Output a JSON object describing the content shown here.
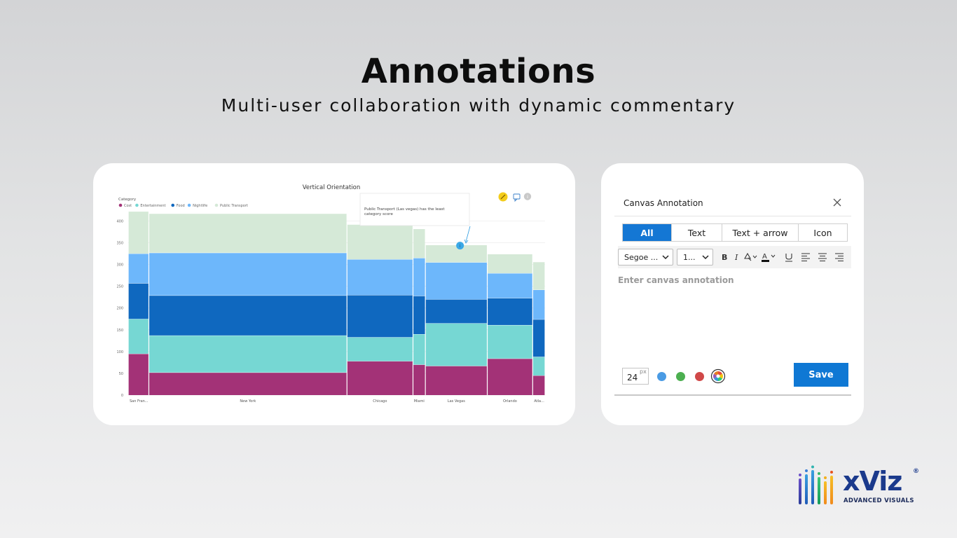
{
  "page": {
    "title": "Annotations",
    "subtitle": "Multi-user collaboration with dynamic commentary"
  },
  "chart_data": {
    "type": "bar",
    "title": "Vertical Orientation",
    "legend_title": "Category",
    "legend_placement": "top-left",
    "categories": [
      "San Fran...",
      "New York",
      "Chicago",
      "Miami",
      "Las Vegas",
      "Orlando",
      "Atla..."
    ],
    "widths": [
      5,
      48,
      16,
      3,
      15,
      11,
      3
    ],
    "yticks": [
      0,
      50,
      100,
      150,
      200,
      250,
      300,
      350,
      400
    ],
    "ylim": [
      0,
      420
    ],
    "grid": true,
    "series": [
      {
        "name": "Cost",
        "color": "#a33277",
        "values": [
          95,
          52,
          78,
          70,
          67,
          84,
          45
        ]
      },
      {
        "name": "Entertainment",
        "color": "#76d7d3",
        "values": [
          80,
          85,
          55,
          70,
          98,
          77,
          43
        ]
      },
      {
        "name": "Food",
        "color": "#0f68bf",
        "values": [
          82,
          92,
          97,
          88,
          55,
          62,
          86
        ]
      },
      {
        "name": "Nightlife",
        "color": "#6db7fb",
        "values": [
          68,
          98,
          82,
          87,
          85,
          57,
          68
        ]
      },
      {
        "name": "Public Transport",
        "color": "#d5e9d7",
        "values": [
          97,
          90,
          80,
          67,
          40,
          44,
          64
        ]
      }
    ],
    "annotation": {
      "text": "Public Transport (Las vegas) has the least category score",
      "category": "Las Vegas",
      "series": "Public Transport"
    }
  },
  "chart_toolbar": {
    "icons": [
      "pencil-icon",
      "comment-icon",
      "info-icon"
    ]
  },
  "panel": {
    "title": "Canvas Annotation",
    "tabs": [
      {
        "label": "All",
        "active": true
      },
      {
        "label": "Text",
        "active": false
      },
      {
        "label": "Text + arrow",
        "active": false
      },
      {
        "label": "Icon",
        "active": false
      }
    ],
    "font_family_value": "Segoe ...",
    "font_size_value": "1...",
    "placeholder": "Enter canvas annotation",
    "size_value": "24",
    "size_unit": "px",
    "swatches": [
      "#4a9be4",
      "#4caf50",
      "#d04848"
    ],
    "save_label": "Save"
  },
  "logo": {
    "word": "xViz",
    "registered": "®",
    "tagline": "ADVANCED  VISUALS"
  }
}
